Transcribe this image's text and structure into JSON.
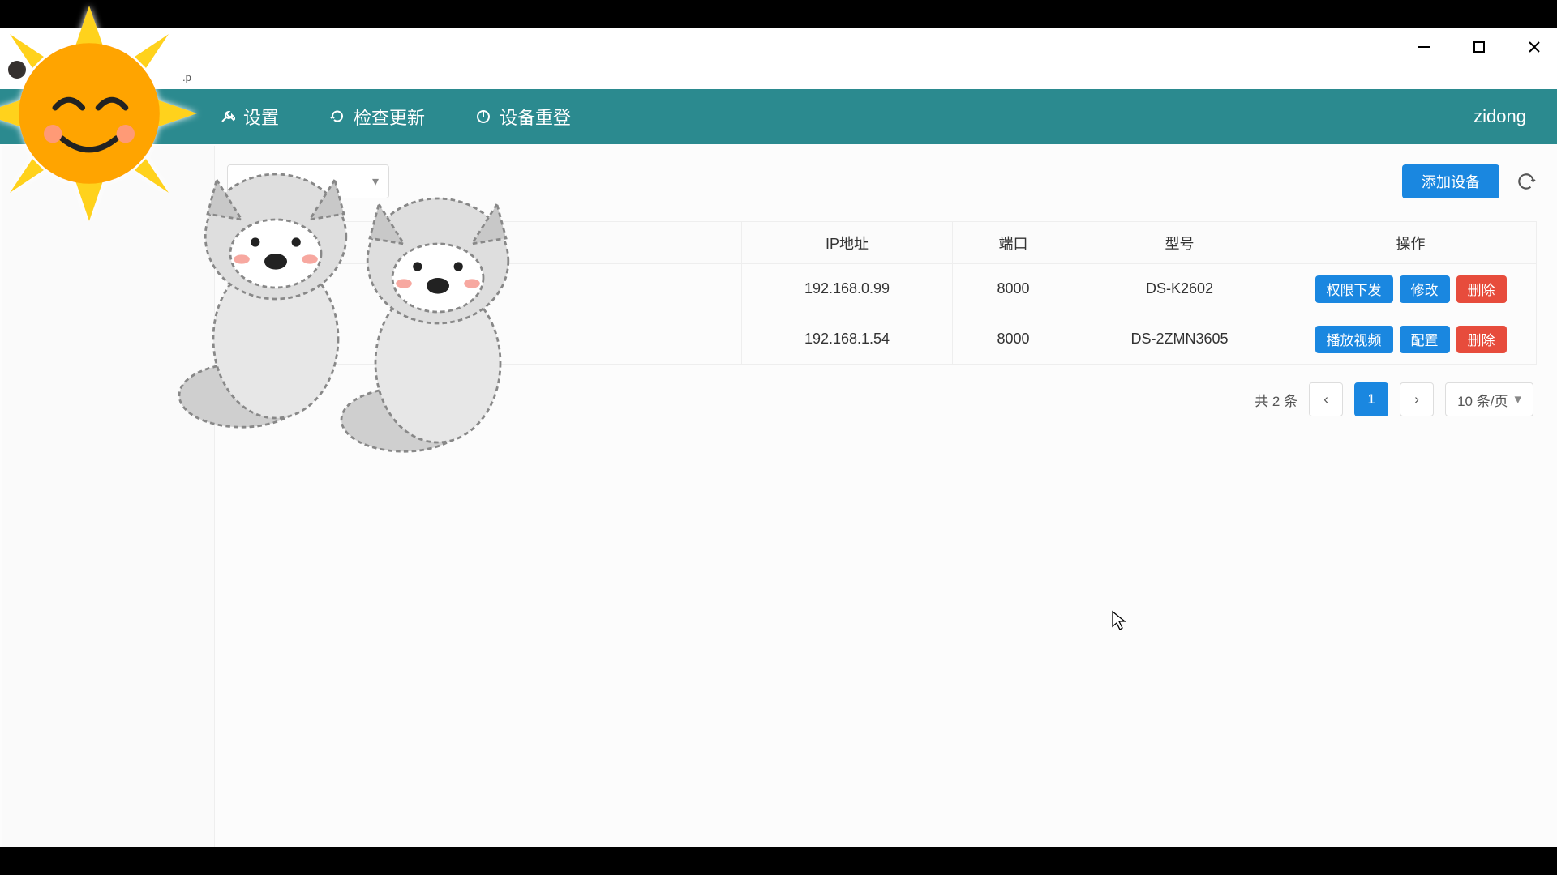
{
  "path_text": ".p",
  "nav": {
    "settings": "设置",
    "check_update": "检查更新",
    "device_relogin": "设备重登"
  },
  "user": {
    "name": "zidong"
  },
  "toolbar": {
    "add_device": "添加设备"
  },
  "table": {
    "headers": {
      "ip": "IP地址",
      "port": "端口",
      "model": "型号",
      "ops": "操作"
    },
    "rows": [
      {
        "ip": "192.168.0.99",
        "port": "8000",
        "model": "DS-K2602",
        "actions": [
          {
            "label": "权限下发",
            "kind": "blue"
          },
          {
            "label": "修改",
            "kind": "blue"
          },
          {
            "label": "删除",
            "kind": "red"
          }
        ]
      },
      {
        "ip": "192.168.1.54",
        "port": "8000",
        "model": "DS-2ZMN3605",
        "actions": [
          {
            "label": "播放视频",
            "kind": "blue"
          },
          {
            "label": "配置",
            "kind": "blue"
          },
          {
            "label": "删除",
            "kind": "red"
          }
        ]
      }
    ]
  },
  "pagination": {
    "total_text": "共 2 条",
    "current": "1",
    "page_size_label": "10 条/页"
  }
}
